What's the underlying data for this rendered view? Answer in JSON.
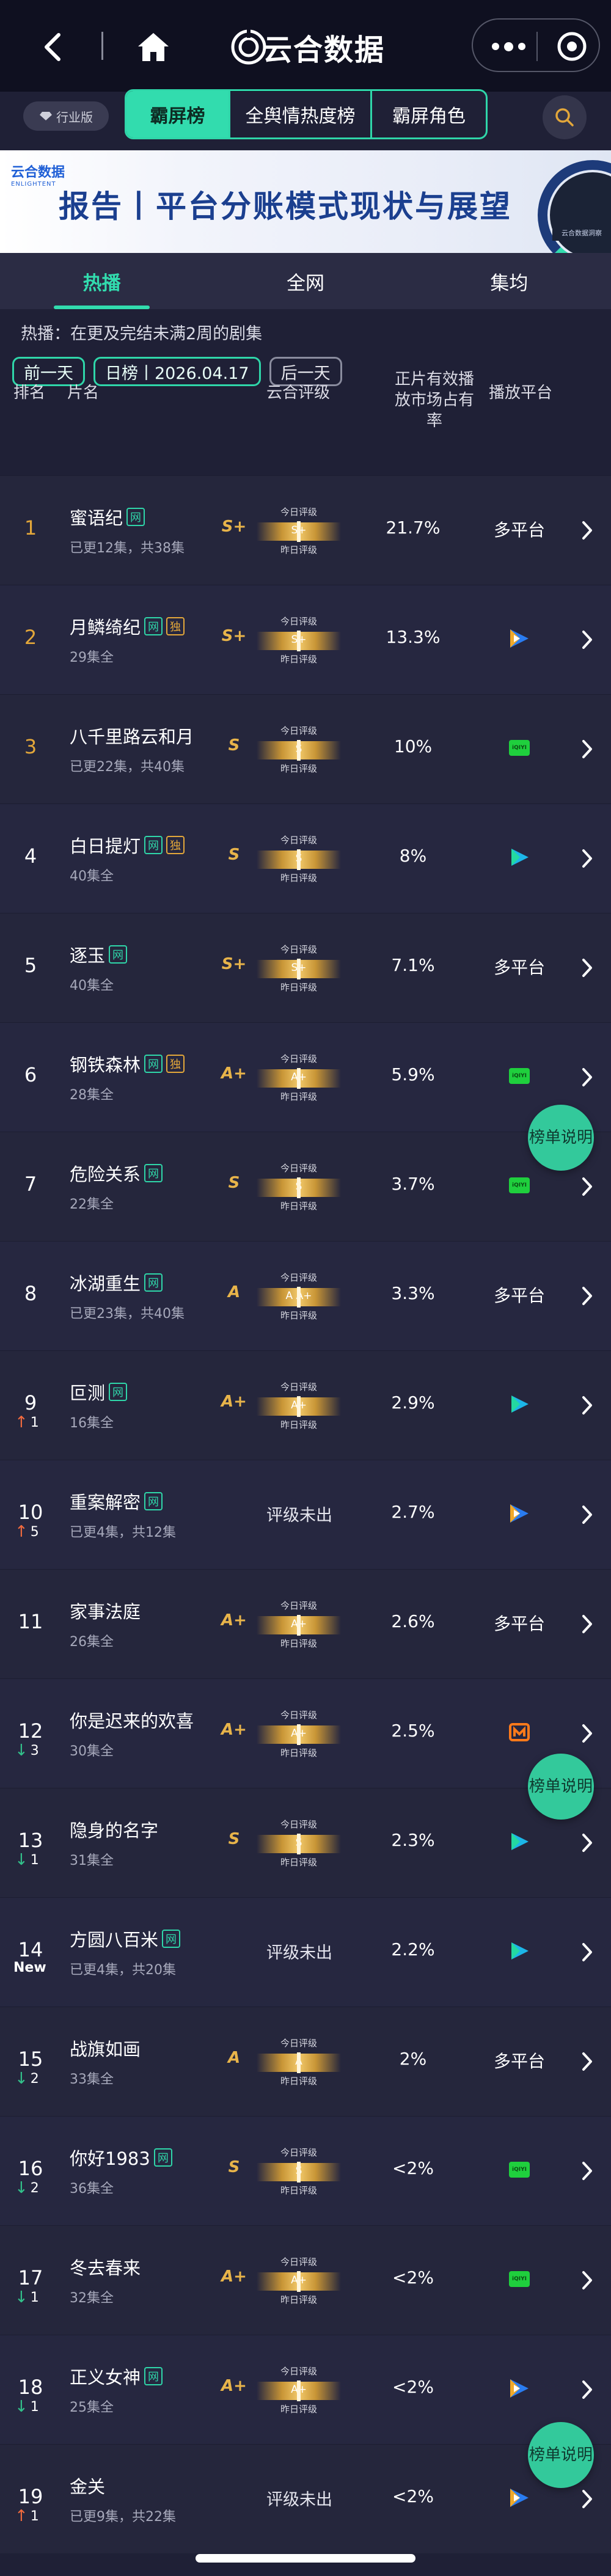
{
  "app_title": "云合数据",
  "industry_badge": "行业版",
  "chip_tabs": [
    "霸屏榜",
    "全舆情热度榜",
    "霸屏角色"
  ],
  "banner": {
    "logo_text": "云合数据",
    "logo_sub": "ENLIGHTENT",
    "title": "报告丨平台分账模式现状与展望",
    "badge": "云合数据洞察"
  },
  "sub_tabs": [
    "热播",
    "全网",
    "集均"
  ],
  "note": "热播：在更及完结未满2周的剧集",
  "date_nav": {
    "prev": "前一天",
    "current": "日榜丨2026.04.17",
    "next": "后一天"
  },
  "headers": {
    "rank": "排名",
    "name": "片名",
    "grade": "云合评级",
    "share": "正片有效播放市场占有率",
    "platform": "播放平台"
  },
  "meter_labels": {
    "today": "今日评级",
    "yesterday": "昨日评级"
  },
  "no_score": "评级未出",
  "float_note": "榜单说明",
  "rows": [
    {
      "rank": "1",
      "name": "蜜语纪",
      "tags": [
        "网"
      ],
      "eps": "已更12集，共38集",
      "grade": "S+",
      "meter": "S+",
      "share": "21.7%",
      "platform": "多平台"
    },
    {
      "rank": "2",
      "name": "月鳞绮纪",
      "tags": [
        "网",
        "独"
      ],
      "eps": "29集全",
      "grade": "S+",
      "meter": "S+",
      "share": "13.3%",
      "platform": "tencent"
    },
    {
      "rank": "3",
      "name": "八千里路云和月",
      "tags": [],
      "eps": "已更22集，共40集",
      "grade": "S",
      "meter": "S",
      "share": "10%",
      "platform": "iqiyi"
    },
    {
      "rank": "4",
      "name": "白日提灯",
      "tags": [
        "网",
        "独"
      ],
      "eps": "40集全",
      "grade": "S",
      "meter": "S",
      "share": "8%",
      "platform": "youku"
    },
    {
      "rank": "5",
      "name": "逐玉",
      "tags": [
        "网"
      ],
      "eps": "40集全",
      "grade": "S+",
      "meter": "S+",
      "share": "7.1%",
      "platform": "多平台"
    },
    {
      "rank": "6",
      "name": "钢铁森林",
      "tags": [
        "网",
        "独"
      ],
      "eps": "28集全",
      "grade": "A+",
      "meter": "A+",
      "share": "5.9%",
      "platform": "iqiyi"
    },
    {
      "rank": "7",
      "name": "危险关系",
      "tags": [
        "网"
      ],
      "eps": "22集全",
      "grade": "S",
      "meter": "S",
      "share": "3.7%",
      "platform": "iqiyi"
    },
    {
      "rank": "8",
      "name": "冰湖重生",
      "tags": [
        "网"
      ],
      "eps": "已更23集，共40集",
      "grade": "A",
      "meter": "A  A+",
      "share": "3.3%",
      "platform": "多平台"
    },
    {
      "rank": "9",
      "trend": "up",
      "trend_val": "1",
      "name": "叵测",
      "tags": [
        "网"
      ],
      "eps": "16集全",
      "grade": "A+",
      "meter": "A+",
      "share": "2.9%",
      "platform": "youku"
    },
    {
      "rank": "10",
      "trend": "up",
      "trend_val": "5",
      "name": "重案解密",
      "tags": [
        "网"
      ],
      "eps": "已更4集，共12集",
      "grade": "",
      "meter": "",
      "share": "2.7%",
      "platform": "tencent"
    },
    {
      "rank": "11",
      "name": "家事法庭",
      "tags": [],
      "eps": "26集全",
      "grade": "A+",
      "meter": "A+",
      "share": "2.6%",
      "platform": "多平台"
    },
    {
      "rank": "12",
      "trend": "down",
      "trend_val": "3",
      "name": "你是迟来的欢喜",
      "tags": [],
      "eps": "30集全",
      "grade": "A+",
      "meter": "A+",
      "share": "2.5%",
      "platform": "mango"
    },
    {
      "rank": "13",
      "trend": "down",
      "trend_val": "1",
      "name": "隐身的名字",
      "tags": [],
      "eps": "31集全",
      "grade": "S",
      "meter": "S",
      "share": "2.3%",
      "platform": "youku"
    },
    {
      "rank": "14",
      "trend": "new",
      "trend_val": "New",
      "name": "方圆八百米",
      "tags": [
        "网"
      ],
      "eps": "已更4集，共20集",
      "grade": "",
      "meter": "",
      "share": "2.2%",
      "platform": "youku"
    },
    {
      "rank": "15",
      "trend": "down",
      "trend_val": "2",
      "name": "战旗如画",
      "tags": [],
      "eps": "33集全",
      "grade": "A",
      "meter": "A",
      "share": "2%",
      "platform": "多平台"
    },
    {
      "rank": "16",
      "trend": "down",
      "trend_val": "2",
      "name": "你好1983",
      "tags": [
        "网"
      ],
      "eps": "36集全",
      "grade": "S",
      "meter": "S",
      "share": "<2%",
      "platform": "iqiyi"
    },
    {
      "rank": "17",
      "trend": "down",
      "trend_val": "1",
      "name": "冬去春来",
      "tags": [],
      "eps": "32集全",
      "grade": "A+",
      "meter": "A+",
      "share": "<2%",
      "platform": "iqiyi"
    },
    {
      "rank": "18",
      "trend": "down",
      "trend_val": "1",
      "name": "正义女神",
      "tags": [
        "网"
      ],
      "eps": "25集全",
      "grade": "A+",
      "meter": "A+",
      "share": "<2%",
      "platform": "tencent"
    },
    {
      "rank": "19",
      "trend": "up",
      "trend_val": "1",
      "name": "金关",
      "tags": [],
      "eps": "已更9集，共22集",
      "grade": "",
      "meter": "",
      "share": "<2%",
      "platform": "tencent"
    }
  ],
  "colors": {
    "accent": "#32dcae",
    "gold": "#e3a73a",
    "bg": "#1f2036"
  }
}
